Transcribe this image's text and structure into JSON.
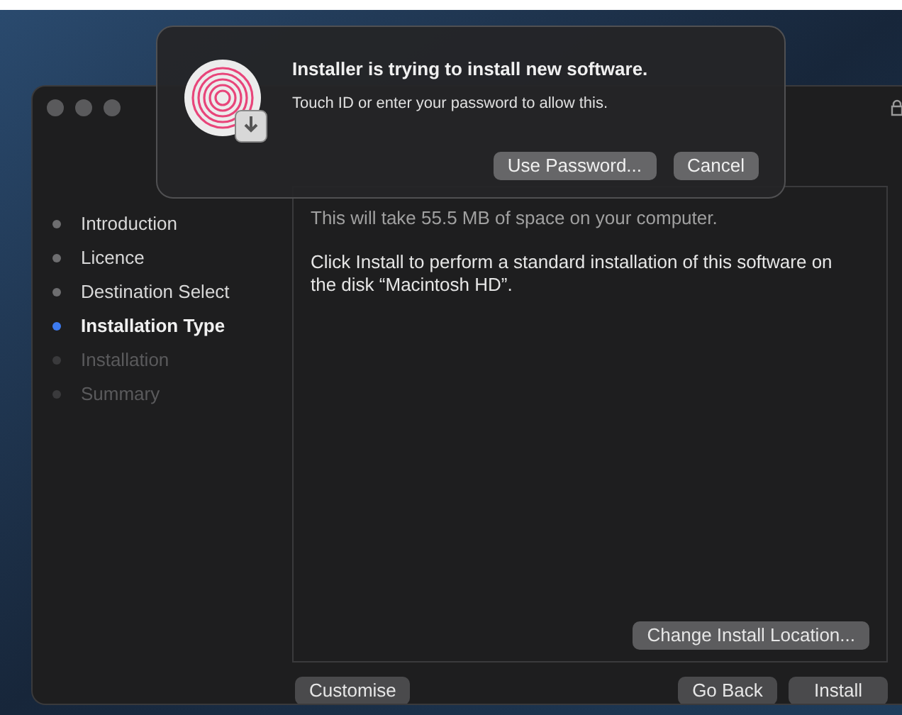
{
  "dialog": {
    "title": "Installer is trying to install new software.",
    "message": "Touch ID or enter your password to allow this.",
    "buttons": [
      "Use Password...",
      "Cancel"
    ]
  },
  "sidebar": {
    "steps": [
      {
        "label": "Introduction",
        "selected": false,
        "disabled": false
      },
      {
        "label": "Licence",
        "selected": false,
        "disabled": false
      },
      {
        "label": "Destination Select",
        "selected": false,
        "disabled": false
      },
      {
        "label": "Installation Type",
        "selected": true,
        "disabled": false
      },
      {
        "label": "Installation",
        "selected": false,
        "disabled": true
      },
      {
        "label": "Summary",
        "selected": false,
        "disabled": true
      }
    ]
  },
  "content": {
    "size_note": "This will take 55.5 MB of space on your computer.",
    "instructions": "Click Install to perform a standard installation of this software on the disk “Macintosh HD”.",
    "location_button": "Change Install Location..."
  },
  "footer": {
    "left_button": "Customise",
    "right_buttons": [
      "Go Back",
      "Install"
    ]
  }
}
